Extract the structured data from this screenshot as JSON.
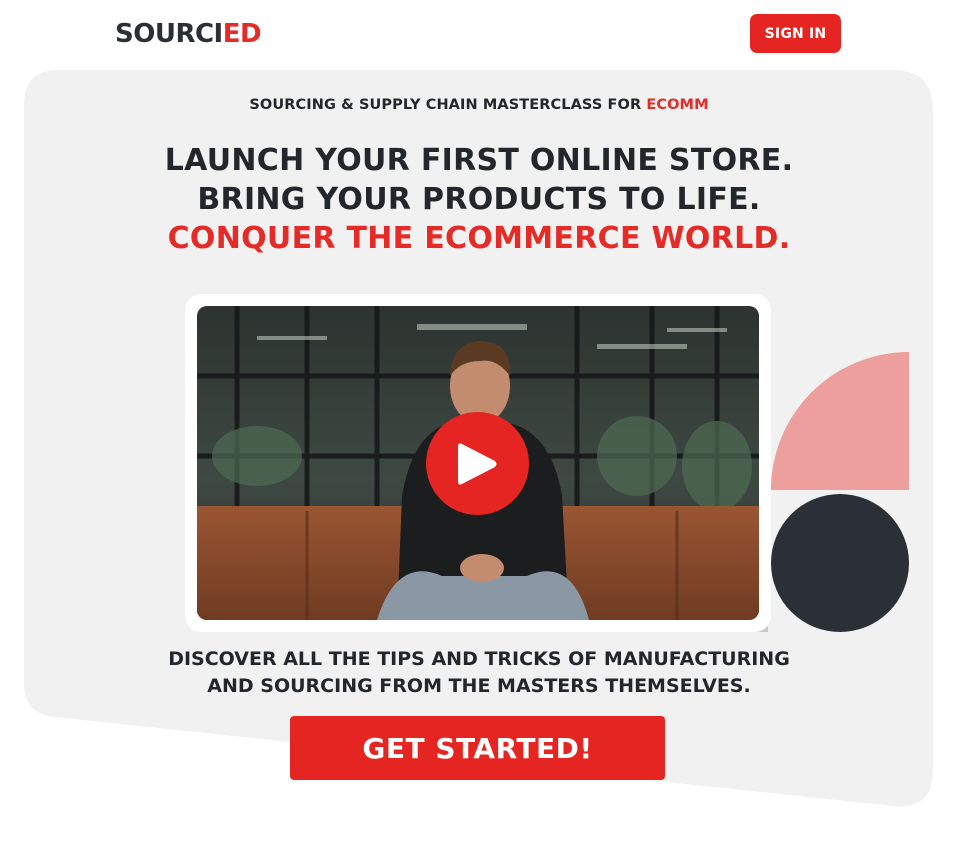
{
  "header": {
    "logo_part1": "SOURCI",
    "logo_part2": "ED",
    "signin_label": "SIGN IN"
  },
  "hero": {
    "eyebrow_text": "SOURCING & SUPPLY CHAIN MASTERCLASS FOR ",
    "eyebrow_accent": "ECOMM",
    "headline_line1": "LAUNCH YOUR FIRST ONLINE STORE.",
    "headline_line2": "BRING YOUR PRODUCTS TO LIFE.",
    "headline_line3": "CONQUER THE ECOMMERCE WORLD.",
    "subtext_line1": "DISCOVER ALL THE TIPS AND TRICKS OF MANUFACTURING",
    "subtext_line2": "AND SOURCING FROM THE MASTERS THEMSELVES.",
    "cta_label": "GET STARTED!"
  },
  "video": {
    "play_icon": "play-icon"
  },
  "colors": {
    "accent": "#e42521",
    "dark": "#2a3035",
    "panel": "#f0f1f0",
    "decor_pink": "#ec9f9d"
  }
}
